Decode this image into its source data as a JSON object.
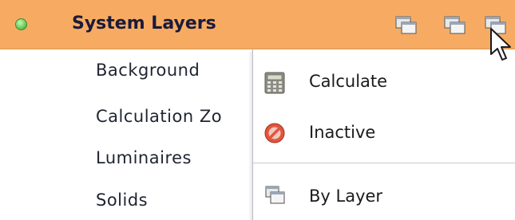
{
  "header": {
    "title": "System Layers",
    "status_color": "#4caf3d",
    "background_color": "#f7ab62"
  },
  "layers": [
    {
      "label": "Background"
    },
    {
      "label": "Calculation Zo"
    },
    {
      "label": "Luminaires"
    },
    {
      "label": "Solids"
    }
  ],
  "context_menu": {
    "items": [
      {
        "label": "Calculate",
        "icon": "calculator-icon"
      },
      {
        "label": "Inactive",
        "icon": "no-entry-icon"
      },
      {
        "label": "By Layer",
        "icon": "layers-icon"
      }
    ]
  }
}
